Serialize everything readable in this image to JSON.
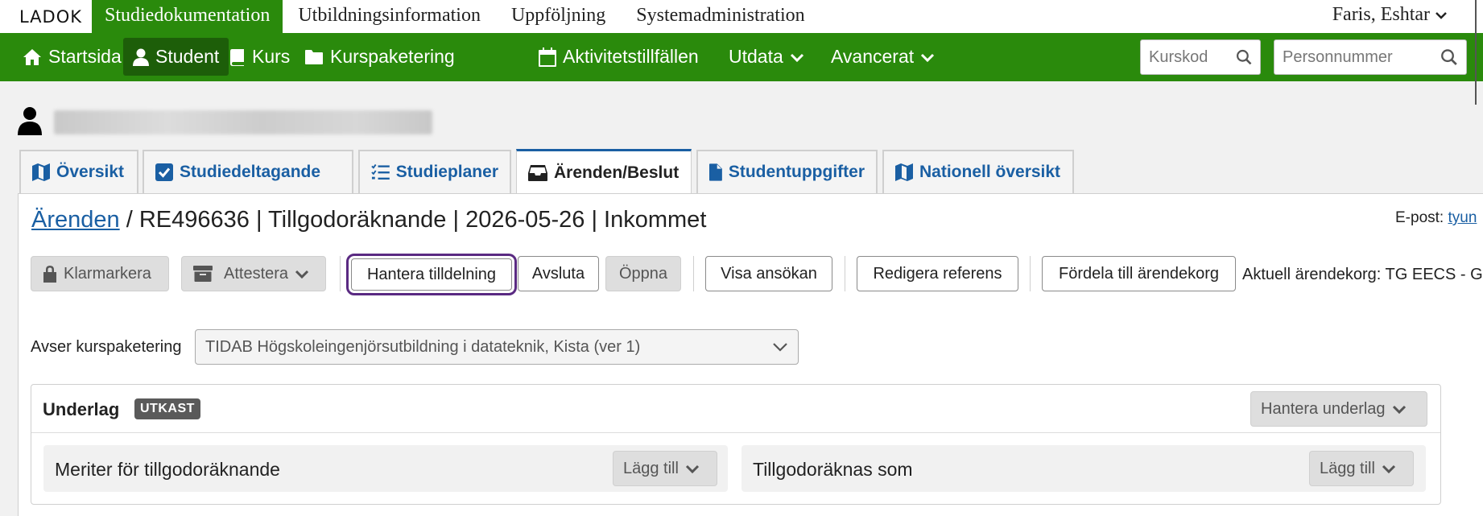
{
  "app": {
    "logo": "LADOK",
    "top_nav": [
      "Studiedokumentation",
      "Utbildningsinformation",
      "Uppföljning",
      "Systemadministration"
    ],
    "user": "Faris, Eshtar"
  },
  "main_nav": {
    "items": [
      {
        "label": "Startsida",
        "icon": "home-icon"
      },
      {
        "label": "Student",
        "icon": "person-icon"
      },
      {
        "label": "Kurs",
        "icon": "book-icon"
      },
      {
        "label": "Kurspaketering",
        "icon": "folder-icon"
      },
      {
        "label": "Aktivitetstillfällen",
        "icon": "calendar-icon"
      },
      {
        "label": "Utdata",
        "icon": "chevron-down-icon"
      },
      {
        "label": "Avancerat",
        "icon": "chevron-down-icon"
      }
    ],
    "search_course_placeholder": "Kurskod",
    "search_person_placeholder": "Personnummer"
  },
  "tabs": [
    {
      "label": "Översikt",
      "icon": "map-icon"
    },
    {
      "label": "Studiedeltagande",
      "icon": "checkbox-icon"
    },
    {
      "label": "Studieplaner",
      "icon": "list-icon"
    },
    {
      "label": "Ärenden/Beslut",
      "icon": "inbox-icon",
      "active": true
    },
    {
      "label": "Studentuppgifter",
      "icon": "document-icon"
    },
    {
      "label": "Nationell översikt",
      "icon": "map-icon"
    }
  ],
  "case": {
    "breadcrumb_link": "Ärenden",
    "title": "/ RE496636 | Tillgodoräknande | 2026-05-26 | Inkommet",
    "email_label": "E-post:",
    "email_value": "tyun"
  },
  "toolbar": {
    "klarmarkera": "Klarmarkera",
    "attestera": "Attestera",
    "hantera_tilldelning": "Hantera tilldelning",
    "avsluta": "Avsluta",
    "oppna": "Öppna",
    "visa_ansokan": "Visa ansökan",
    "redigera_referens": "Redigera referens",
    "fordela": "Fördela till ärendekorg",
    "aktuell": "Aktuell ärendekorg: TG EECS - G"
  },
  "avser": {
    "label": "Avser kurspaketering",
    "value": "TIDAB Högskoleingenjörsutbildning i datateknik, Kista (ver 1)"
  },
  "underlag": {
    "title": "Underlag",
    "badge": "UTKAST",
    "manage": "Hantera underlag",
    "left_title": "Meriter för tillgodoräknande",
    "left_btn": "Lägg till",
    "right_title": "Tillgodoräknas som",
    "right_btn": "Lägg till"
  }
}
